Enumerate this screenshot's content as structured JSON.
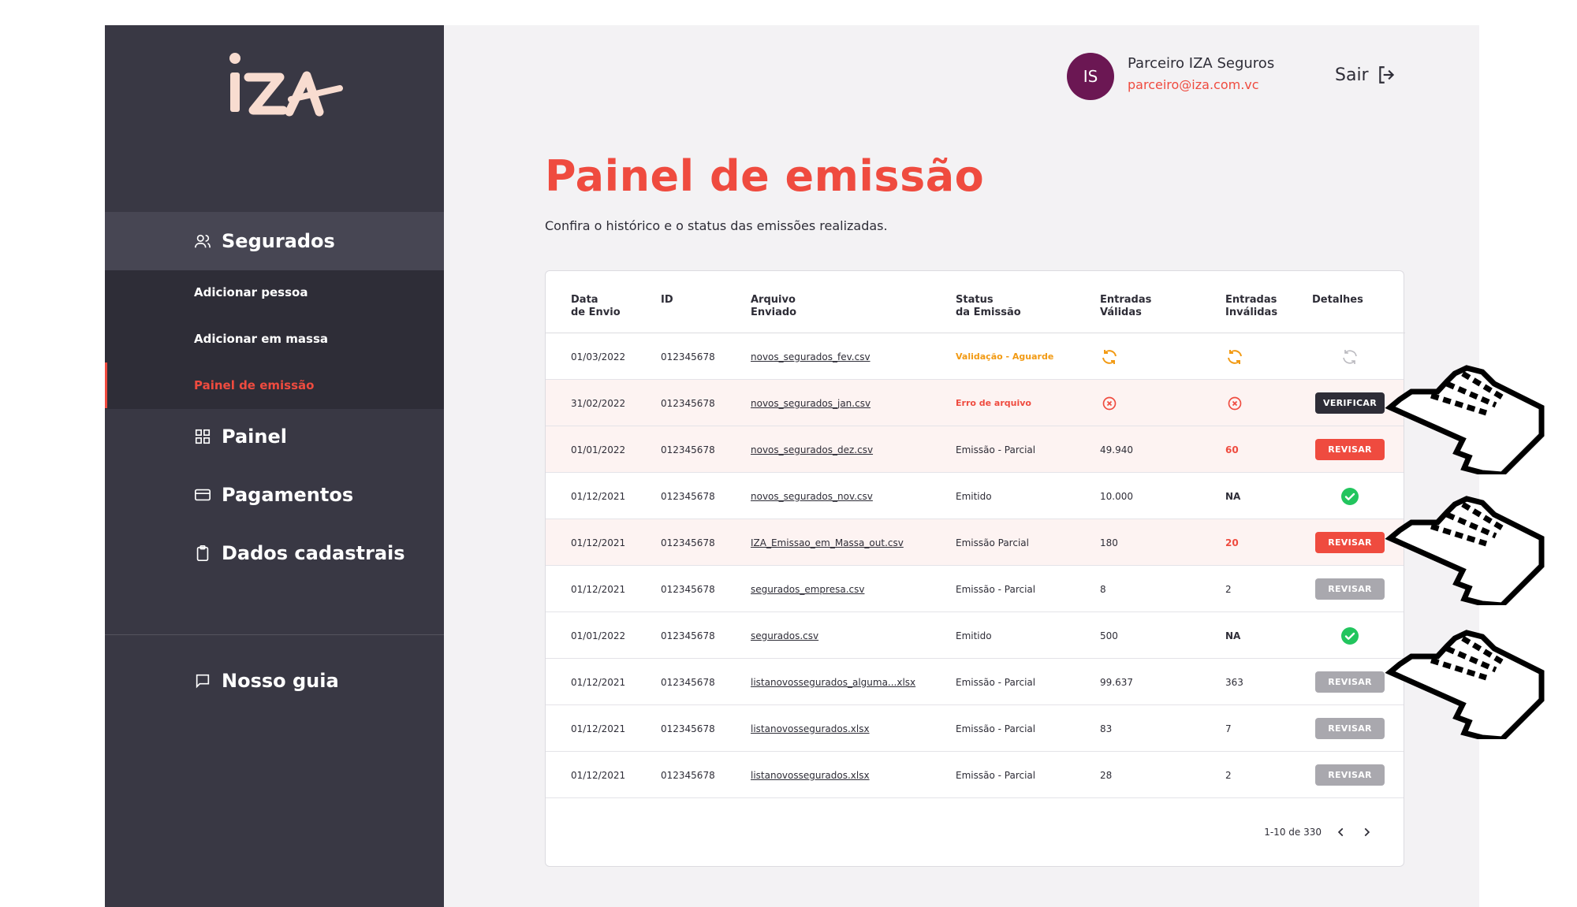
{
  "brand": {
    "logo_text": "iza"
  },
  "user": {
    "initials": "IS",
    "name": "Parceiro IZA Seguros",
    "email": "parceiro@iza.com.vc",
    "logout_label": "Sair"
  },
  "sidebar": {
    "section": "Segurados",
    "subitems": [
      "Adicionar pessoa",
      "Adicionar em massa",
      "Painel de emissão"
    ],
    "items": [
      "Painel",
      "Pagamentos",
      "Dados cadastrais"
    ],
    "guide": "Nosso guia"
  },
  "page": {
    "title": "Painel de emissão",
    "subtitle": "Confira o histórico e o status das emissões realizadas."
  },
  "table": {
    "headers": [
      "Data\nde Envio",
      "ID",
      "Arquivo\nEnviado",
      "Status\nda Emissão",
      "Entradas\nVálidas",
      "Entradas\nInválidas",
      "Detalhes"
    ],
    "rows": [
      {
        "date": "01/03/2022",
        "id": "012345678",
        "file": "novos_segurados_fev.csv",
        "status": "Validação - Aguarde",
        "valid": "",
        "invalid": "",
        "detail": ""
      },
      {
        "date": "31/02/2022",
        "id": "012345678",
        "file": "novos_segurados_jan.csv",
        "status": "Erro de arquivo",
        "valid": "",
        "invalid": "",
        "detail": "VERIFICAR"
      },
      {
        "date": "01/01/2022",
        "id": "012345678",
        "file": "novos_segurados_dez.csv",
        "status": "Emissão - Parcial",
        "valid": "49.940",
        "invalid": "60",
        "detail": "REVISAR"
      },
      {
        "date": "01/12/2021",
        "id": "012345678",
        "file": "novos_segurados_nov.csv",
        "status": "Emitido",
        "valid": "10.000",
        "invalid": "NA",
        "detail": ""
      },
      {
        "date": "01/12/2021",
        "id": "012345678",
        "file": "IZA_Emissao_em_Massa_out.csv",
        "status": "Emissão Parcial",
        "valid": "180",
        "invalid": "20",
        "detail": "REVISAR"
      },
      {
        "date": "01/12/2021",
        "id": "012345678",
        "file": "segurados_empresa.csv",
        "status": "Emissão - Parcial",
        "valid": "8",
        "invalid": "2",
        "detail": "REVISAR"
      },
      {
        "date": "01/01/2022",
        "id": "012345678",
        "file": "segurados.csv",
        "status": "Emitido",
        "valid": "500",
        "invalid": "NA",
        "detail": ""
      },
      {
        "date": "01/12/2021",
        "id": "012345678",
        "file": "listanovossegurados_alguma...xlsx",
        "status": "Emissão - Parcial",
        "valid": "99.637",
        "invalid": "363",
        "detail": "REVISAR"
      },
      {
        "date": "01/12/2021",
        "id": "012345678",
        "file": "listanovossegurados.xlsx",
        "status": "Emissão - Parcial",
        "valid": "83",
        "invalid": "7",
        "detail": "REVISAR"
      },
      {
        "date": "01/12/2021",
        "id": "012345678",
        "file": "listanovossegurados.xlsx",
        "status": "Emissão - Parcial",
        "valid": "28",
        "invalid": "2",
        "detail": "REVISAR"
      }
    ],
    "pagination": "1-10 de 330"
  },
  "colors": {
    "accent": "#ef4b3f",
    "sidebar": "#393844",
    "avatar": "#6b1753",
    "warning": "#f29a13",
    "success": "#22c55e"
  }
}
